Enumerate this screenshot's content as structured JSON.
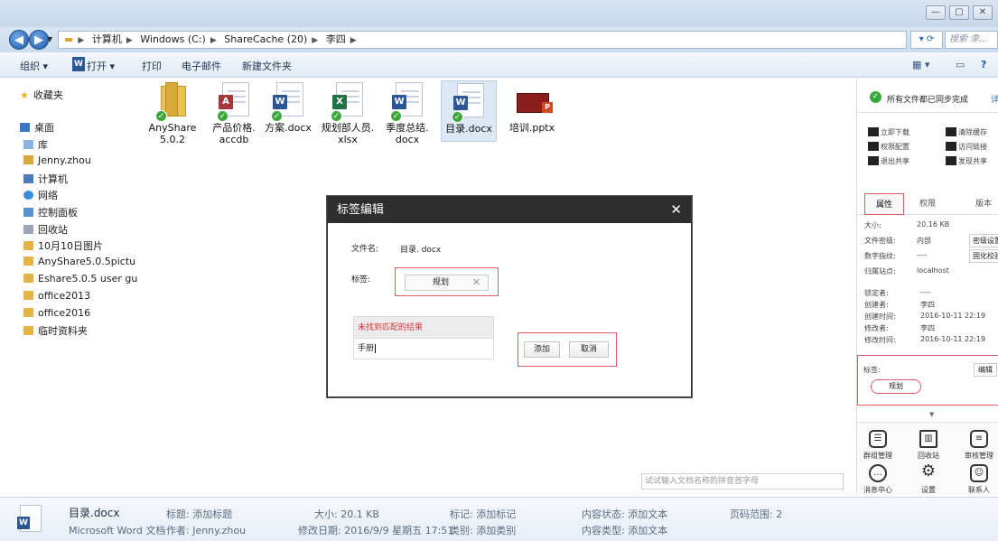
{
  "window": {
    "min": "—",
    "max": "▢",
    "close": "✕"
  },
  "address": {
    "crumbs": [
      "计算机",
      "Windows (C:)",
      "ShareCache (20)",
      "李四"
    ],
    "search_placeholder": "搜索 李..."
  },
  "toolbar": {
    "organize": "组织 ▾",
    "open": "打开 ▾",
    "print": "打印",
    "email": "电子邮件",
    "new_folder": "新建文件夹"
  },
  "sidebar": {
    "items": [
      "收藏夹",
      "桌面",
      "库",
      "Jenny.zhou",
      "计算机",
      "网络",
      "控制面板",
      "回收站",
      "10月10日图片",
      "AnyShare5.0.5pictu",
      "Eshare5.0.5 user gu",
      "office2013",
      "office2016",
      "临时资料夹"
    ]
  },
  "files": [
    {
      "name": "AnyShare 5.0.2",
      "type": "folder"
    },
    {
      "name": "产品价格. accdb",
      "type": "accdb"
    },
    {
      "name": "方案.docx",
      "type": "docx"
    },
    {
      "name": "规划部人员. xlsx",
      "type": "xlsx"
    },
    {
      "name": "季度总结. docx",
      "type": "docx"
    },
    {
      "name": "目录.docx",
      "type": "docx"
    },
    {
      "name": "培训.pptx",
      "type": "pptx"
    }
  ],
  "dialog": {
    "title": "标签编辑",
    "close": "✕",
    "filename_label": "文件名:",
    "filename_value": "目录. docx",
    "tag_label": "标签:",
    "tag_value": "规划",
    "tag_remove": "✕",
    "no_result": "未找到匹配的结果",
    "input_value": "手册",
    "add_button": "添加",
    "cancel_button": "取消"
  },
  "right_panel": {
    "sync_status": "所有文件都已同步完成",
    "sync_more": "详",
    "actions": {
      "download": "立即下载",
      "clear_cache": "清除缓存",
      "permission": "权限配置",
      "access_link": "访问链接",
      "exit_share": "退出共享",
      "discover_share": "发现共享"
    },
    "tabs": {
      "props": "属性",
      "perm": "权限",
      "version": "版本"
    },
    "props": {
      "size_label": "大小:",
      "size_value": "20.16 KB",
      "secret_label": "文件密级:",
      "secret_value": "内部",
      "secret_btn": "密级设置",
      "digital_label": "数字指纹:",
      "digital_value": "----",
      "digital_btn": "固化校验",
      "site_label": "归属站点:",
      "site_value": "localhost",
      "locker_label": "锁定者:",
      "locker_value": "----",
      "creator_label": "创建者:",
      "creator_value": "李四",
      "create_time_label": "创建时间:",
      "create_time_value": "2016-10-11 22:19",
      "modifier_label": "修改者:",
      "modifier_value": "李四",
      "modify_time_label": "修改时间:",
      "modify_time_value": "2016-10-11 22:19"
    },
    "tag_label": "标签:",
    "tag_edit": "编辑",
    "tag_value": "规划",
    "bottom": [
      "群组管理",
      "回收站",
      "审核管理",
      "消息中心",
      "设置",
      "联系人"
    ]
  },
  "hint_input": "试试输入文档名称的拼音首字母",
  "status": {
    "filename": "目录.docx",
    "filetype": "Microsoft Word 文档",
    "title": "标题: 添加标题",
    "author": "作者: Jenny.zhou",
    "size": "大小: 20.1 KB",
    "modified": "修改日期: 2016/9/9 星期五 17:51",
    "tags": "标记: 添加标记",
    "category": "类别: 添加类别",
    "content_status": "内容状态: 添加文本",
    "content_type": "内容类型: 添加文本",
    "page_range": "页码范围: 2"
  }
}
